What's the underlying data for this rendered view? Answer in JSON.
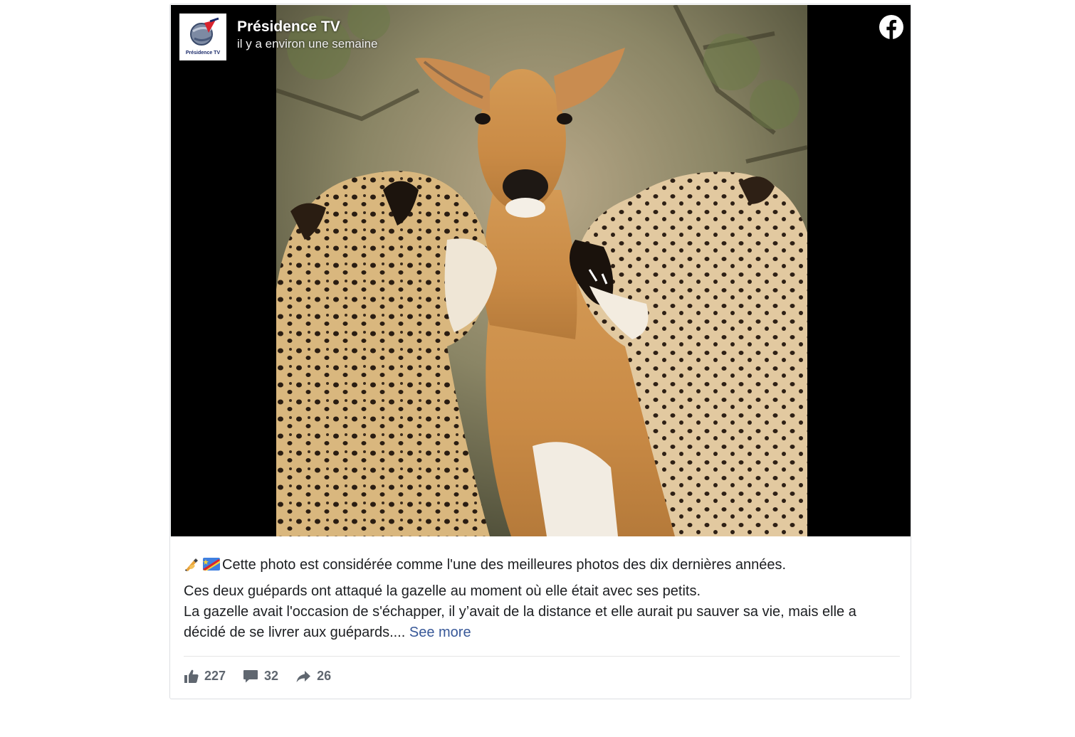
{
  "post": {
    "page_name": "Présidence TV",
    "timestamp": "il y a environ une semaine",
    "avatar_label": "Présidence TV",
    "caption_line1": "Cette photo est considérée comme l'une des meilleures photos des dix dernières années.",
    "caption_line2": "Ces deux guépards ont attaqué la gazelle au moment où elle était avec ses petits.",
    "caption_line3": "La gazelle avait l'occasion de s'échapper, il y’avait de la distance et elle aurait pu sauver sa vie, mais elle a décidé de se livrer aux guépards....",
    "see_more": "See more"
  },
  "reactions": {
    "likes": "227",
    "comments": "32",
    "shares": "26"
  },
  "icons": {
    "platform": "facebook-icon",
    "like": "thumbs-up-icon",
    "comment": "comment-bubble-icon",
    "share": "share-arrow-icon",
    "emoji_1": "writing-hand-icon",
    "emoji_2": "dr-congo-flag-icon"
  },
  "colors": {
    "link": "#385898",
    "text": "#1c1e21",
    "muted": "#606770",
    "border": "#dddfe2"
  }
}
